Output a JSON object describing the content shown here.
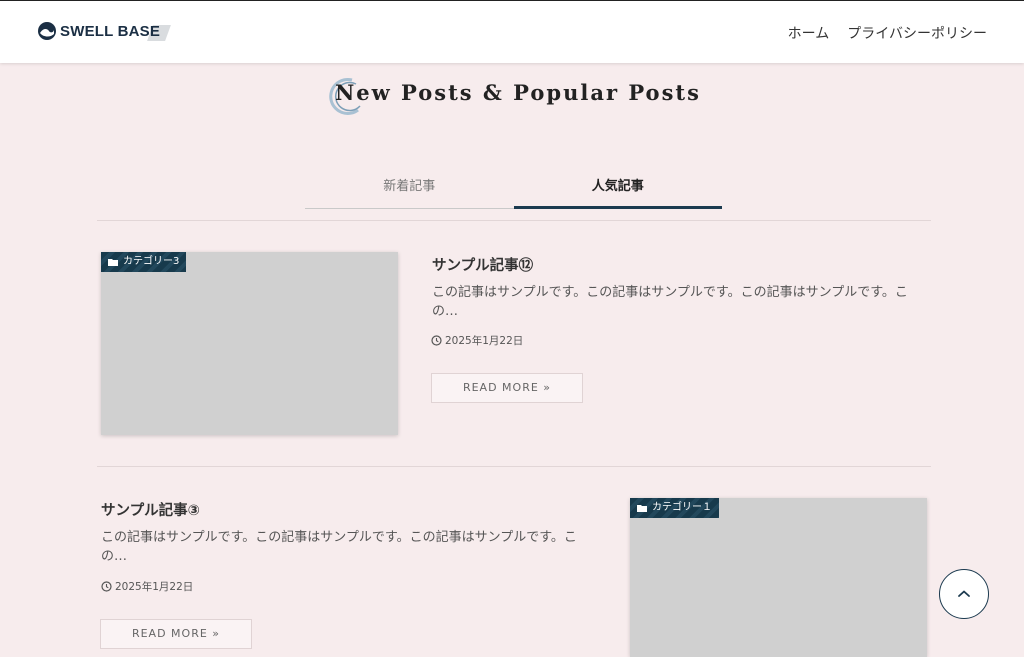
{
  "header": {
    "logo_text": "SWELL BASE",
    "nav": [
      "ホーム",
      "プライバシーポリシー"
    ]
  },
  "section": {
    "title": "New Posts & Popular Posts"
  },
  "tabs": [
    {
      "label": "新着記事",
      "active": false
    },
    {
      "label": "人気記事",
      "active": true
    }
  ],
  "posts": [
    {
      "category": "カテゴリー3",
      "title": "サンプル記事⑫",
      "excerpt": "この記事はサンプルです。この記事はサンプルです。この記事はサンプルです。この…",
      "date": "2025年1月22日",
      "read_more": "READ MORE »"
    },
    {
      "category": "カテゴリー１",
      "title": "サンプル記事③",
      "excerpt": "この記事はサンプルです。この記事はサンプルです。この記事はサンプルです。この…",
      "date": "2025年1月22日",
      "read_more": "READ MORE »"
    }
  ],
  "colors": {
    "background": "#f7eced",
    "accent": "#1b3a4f",
    "thumbnail": "#d0d0d0"
  },
  "icons": {
    "category": "folder-icon",
    "date": "clock-icon",
    "back_to_top": "chevron-up-icon"
  }
}
